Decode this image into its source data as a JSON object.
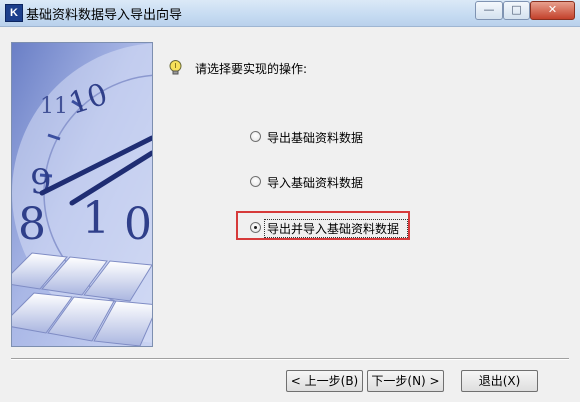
{
  "window": {
    "title": "基础资料数据导入导出向导",
    "icon": "app-k3-icon",
    "controls": {
      "minimize": "—",
      "maximize": "□",
      "close": "✕"
    }
  },
  "prompt": {
    "icon": "lightbulb-icon",
    "text": "请选择要实现的操作:"
  },
  "options": [
    {
      "label": "导出基础资料数据",
      "selected": false
    },
    {
      "label": "导入基础资料数据",
      "selected": false
    },
    {
      "label": "导出并导入基础资料数据",
      "selected": true
    }
  ],
  "buttons": {
    "back": "< 上一步(B)",
    "next": "下一步(N) >",
    "exit": "退出(X)"
  },
  "colors": {
    "highlight": "#d63a3a",
    "art_accent": "#3b4fa0"
  }
}
